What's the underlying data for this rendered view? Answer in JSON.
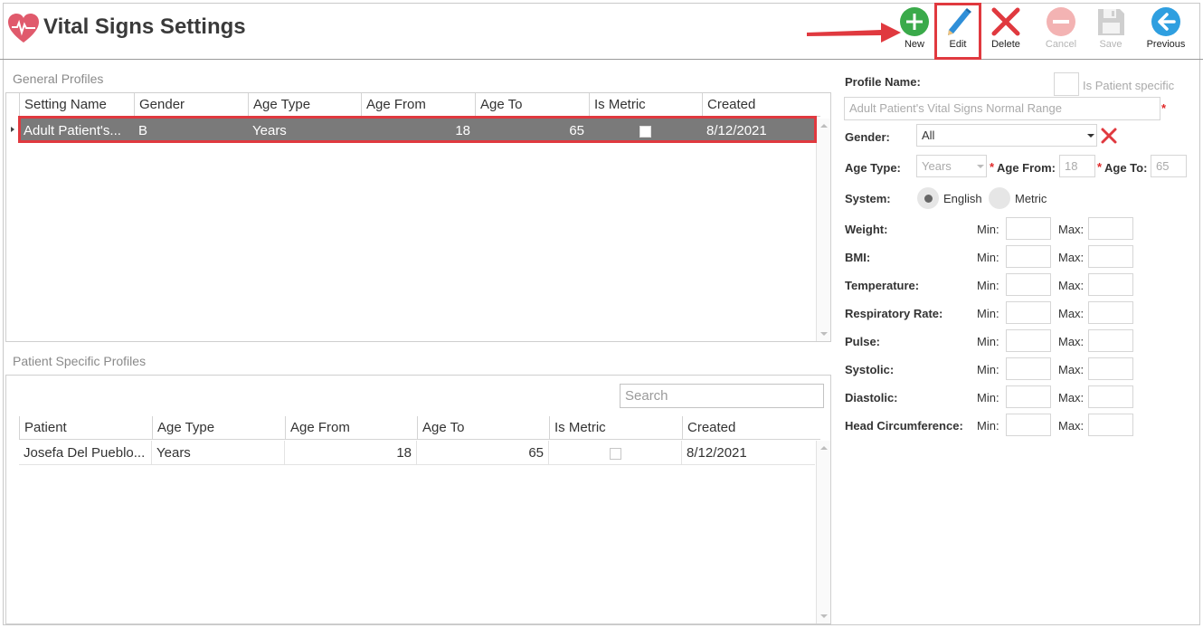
{
  "app": {
    "title": "Vital Signs Settings"
  },
  "toolbar": {
    "new_label": "New",
    "edit_label": "Edit",
    "delete_label": "Delete",
    "cancel_label": "Cancel",
    "save_label": "Save",
    "previous_label": "Previous"
  },
  "general_profiles": {
    "label": "General Profiles",
    "columns": [
      "Setting Name",
      "Gender",
      "Age Type",
      "Age From",
      "Age To",
      "Is Metric",
      "Created"
    ],
    "rows": [
      {
        "setting_name": "Adult Patient's...",
        "gender": "B",
        "age_type": "Years",
        "age_from": "18",
        "age_to": "65",
        "is_metric": false,
        "created": "8/12/2021"
      }
    ]
  },
  "patient_profiles": {
    "label": "Patient Specific Profiles",
    "search_placeholder": "Search",
    "columns": [
      "Patient",
      "Age Type",
      "Age From",
      "Age To",
      "Is Metric",
      "Created"
    ],
    "rows": [
      {
        "patient": "Josefa Del Pueblo...",
        "age_type": "Years",
        "age_from": "18",
        "age_to": "65",
        "is_metric": false,
        "created": "8/12/2021"
      }
    ]
  },
  "form": {
    "profile_name_label": "Profile Name:",
    "is_patient_specific_label": "Is Patient specific",
    "profile_name_value": "Adult Patient's Vital Signs Normal Range",
    "gender_label": "Gender:",
    "gender_value": "All",
    "age_type_label": "Age Type:",
    "age_type_value": "Years",
    "age_from_label": "Age From:",
    "age_from_value": "18",
    "age_to_label": "Age To:",
    "age_to_value": "65",
    "system_label": "System:",
    "system_english": "English",
    "system_metric": "Metric",
    "system_selected": "English",
    "min_label": "Min:",
    "max_label": "Max:",
    "vitals": [
      "Weight:",
      "BMI:",
      "Temperature:",
      "Respiratory Rate:",
      "Pulse:",
      "Systolic:",
      "Diastolic:",
      "Head Circumference:"
    ]
  },
  "colors": {
    "accent_red": "#e0393f",
    "new_green": "#3aaa4a",
    "edit_blue": "#2f8fd8",
    "previous_blue": "#2f9fe0",
    "selected_row": "#7a7a7a"
  }
}
